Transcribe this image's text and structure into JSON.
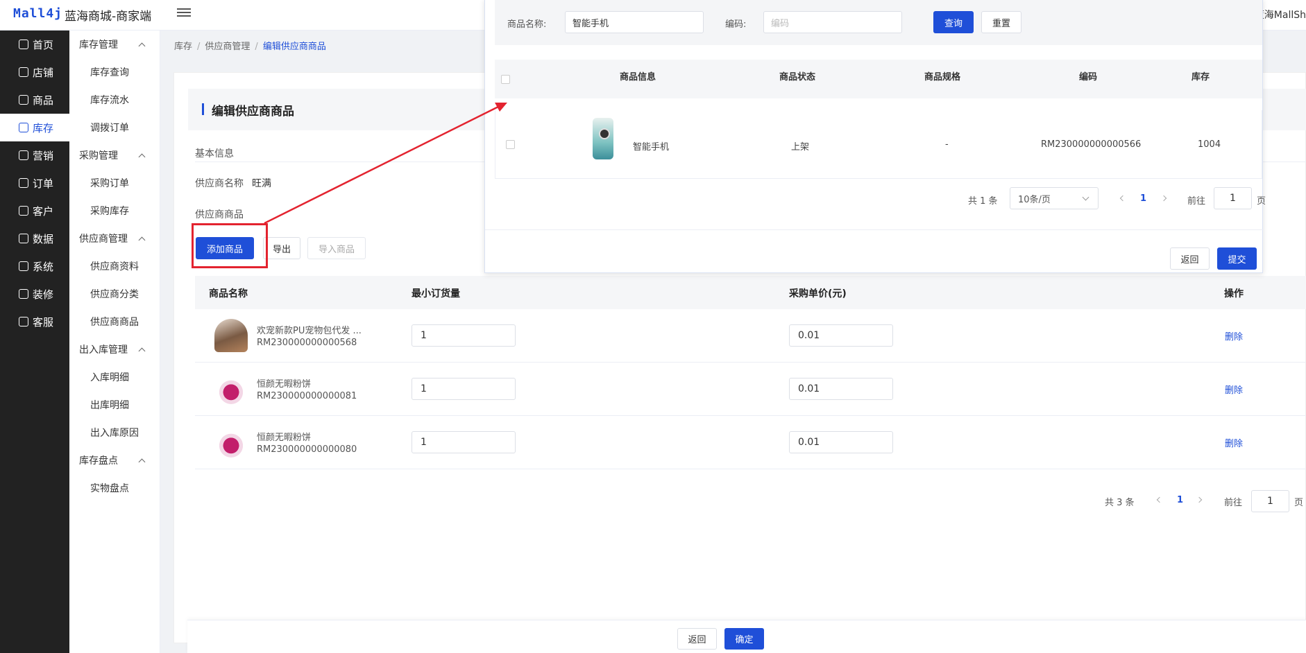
{
  "header": {
    "logo": "Mall4j",
    "app_title": "蓝海商城-商家端",
    "user_name": "蓝海MallSh"
  },
  "nav": {
    "items": [
      {
        "label": "首页",
        "icon": "home-icon"
      },
      {
        "label": "店铺",
        "icon": "shop-icon"
      },
      {
        "label": "商品",
        "icon": "product-icon"
      },
      {
        "label": "库存",
        "icon": "inventory-icon"
      },
      {
        "label": "营销",
        "icon": "marketing-icon"
      },
      {
        "label": "订单",
        "icon": "order-icon"
      },
      {
        "label": "客户",
        "icon": "customer-icon"
      },
      {
        "label": "数据",
        "icon": "data-icon"
      },
      {
        "label": "系统",
        "icon": "settings-icon"
      },
      {
        "label": "装修",
        "icon": "decorate-icon"
      },
      {
        "label": "客服",
        "icon": "service-icon"
      }
    ]
  },
  "subnav": {
    "groups": [
      {
        "label": "库存管理",
        "items": [
          "库存查询",
          "库存流水",
          "调拨订单"
        ]
      },
      {
        "label": "采购管理",
        "items": [
          "采购订单",
          "采购库存"
        ]
      },
      {
        "label": "供应商管理",
        "items": [
          "供应商资料",
          "供应商分类",
          "供应商商品"
        ]
      },
      {
        "label": "出入库管理",
        "items": [
          "入库明细",
          "出库明细",
          "出入库原因"
        ]
      },
      {
        "label": "库存盘点",
        "items": [
          "实物盘点"
        ]
      }
    ]
  },
  "breadcrumb": {
    "items": [
      "库存",
      "供应商管理"
    ],
    "current": "编辑供应商商品",
    "separator": "/"
  },
  "page": {
    "title": "编辑供应商商品",
    "basic_info_label": "基本信息",
    "supplier_name_label": "供应商名称",
    "supplier_name_value": "旺满",
    "supplier_products_label": "供应商商品",
    "add_button": "添加商品",
    "export_button": "导出",
    "import_button": "导入商品"
  },
  "table": {
    "columns": [
      "商品名称",
      "最小订货量",
      "采购单价(元)",
      "操作"
    ],
    "rows": [
      {
        "name": "欢宠新款PU宠物包代发 ...",
        "code": "RM230000000000568",
        "min_qty": "1",
        "price": "0.01",
        "action": "删除",
        "thumb": "pet-bag-image"
      },
      {
        "name": "恒颜无暇粉饼",
        "code": "RM230000000000081",
        "min_qty": "1",
        "price": "0.01",
        "action": "删除",
        "thumb": "perfume-image"
      },
      {
        "name": "恒颜无暇粉饼",
        "code": "RM230000000000080",
        "min_qty": "1",
        "price": "0.01",
        "action": "删除",
        "thumb": "perfume-image"
      }
    ],
    "pager": {
      "total": "共 3 条",
      "page": "1",
      "goto_label": "前往",
      "goto_value": "1",
      "page_unit": "页"
    }
  },
  "footer": {
    "back_button": "返回",
    "confirm_button": "确定"
  },
  "modal": {
    "name_label": "商品名称:",
    "name_value": "智能手机",
    "code_label": "编码:",
    "code_placeholder": "编码",
    "query_button": "查询",
    "reset_button": "重置",
    "columns": [
      "商品信息",
      "商品状态",
      "商品规格",
      "编码",
      "库存"
    ],
    "rows": [
      {
        "name": "智能手机",
        "status": "上架",
        "spec": "-",
        "code": "RM230000000000566",
        "stock": "1004",
        "thumb": "phone-image"
      }
    ],
    "pager": {
      "total": "共 1 条",
      "page_size": "10条/页",
      "page": "1",
      "goto_label": "前往",
      "goto_value": "1",
      "page_unit": "页"
    },
    "back_button": "返回",
    "submit_button": "提交"
  },
  "colors": {
    "primary": "#1f4fd8",
    "nav_bg": "#222222",
    "highlight_red": "#e3232f"
  }
}
